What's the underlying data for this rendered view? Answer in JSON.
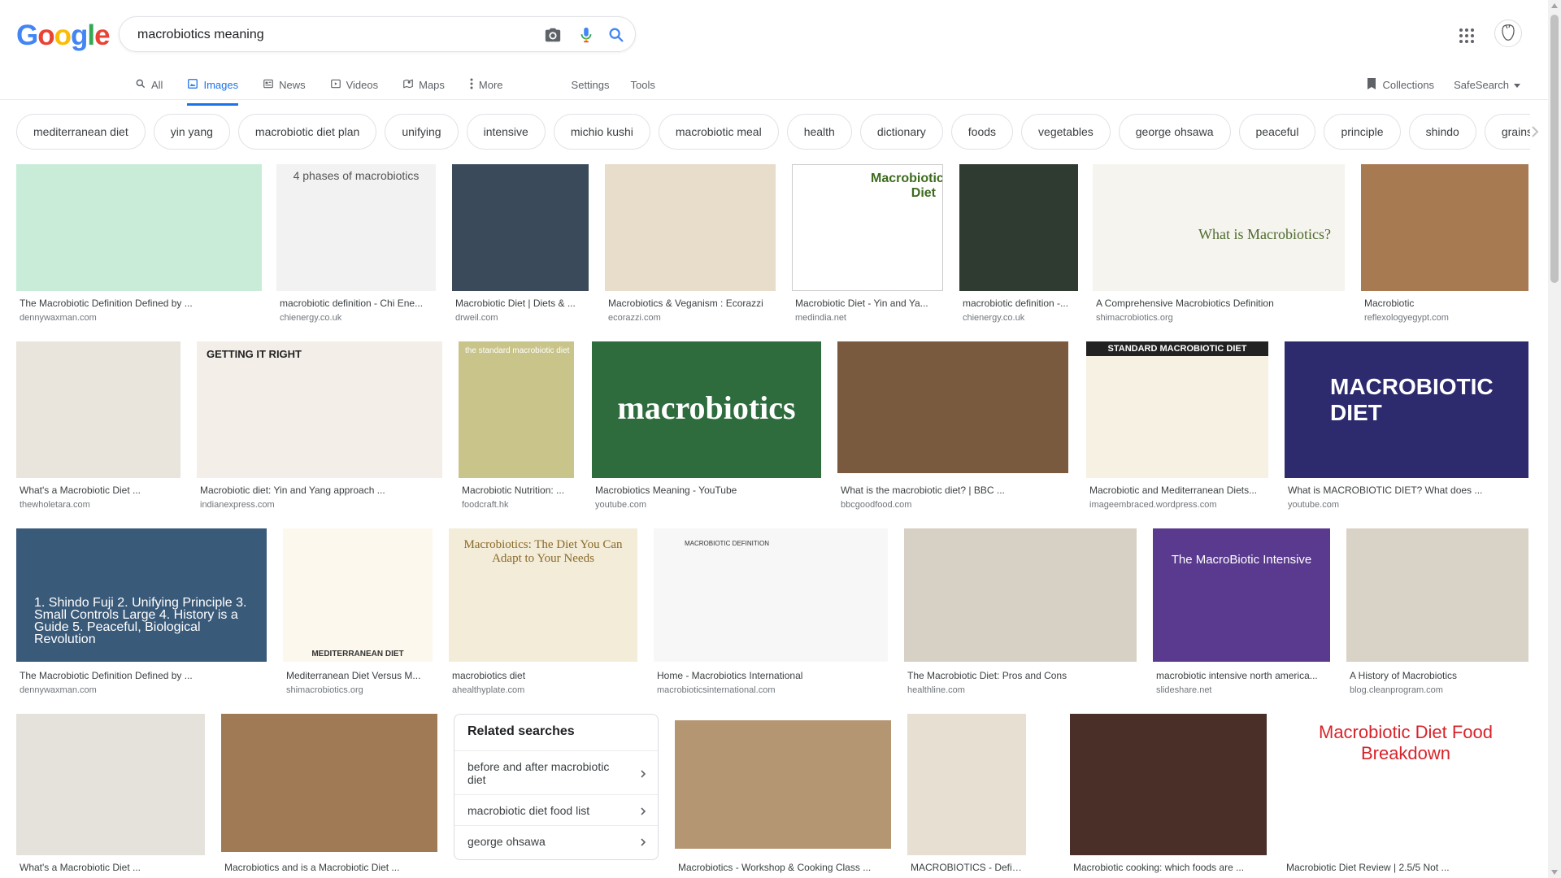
{
  "logo": {
    "letters": [
      "G",
      "o",
      "o",
      "g",
      "l",
      "e"
    ],
    "colors": [
      "#4285F4",
      "#EA4335",
      "#FBBC05",
      "#4285F4",
      "#34A853",
      "#EA4335"
    ]
  },
  "search": {
    "value": "macrobiotics meaning"
  },
  "tabs": [
    {
      "label": "All",
      "icon": "search-icon"
    },
    {
      "label": "Images",
      "icon": "image-icon",
      "active": true
    },
    {
      "label": "News",
      "icon": "news-icon"
    },
    {
      "label": "Videos",
      "icon": "video-icon"
    },
    {
      "label": "Maps",
      "icon": "map-icon"
    },
    {
      "label": "More",
      "icon": "more-vert-icon"
    }
  ],
  "tools": {
    "settings": "Settings",
    "tools": "Tools"
  },
  "right": {
    "collections": "Collections",
    "safesearch": "SafeSearch"
  },
  "chips": [
    "mediterranean diet",
    "yin yang",
    "macrobiotic diet plan",
    "unifying",
    "intensive",
    "michio kushi",
    "macrobiotic meal",
    "health",
    "dictionary",
    "foods",
    "vegetables",
    "george ohsawa",
    "peaceful",
    "principle",
    "shindo",
    "grains"
  ],
  "results": [
    {
      "title": "The Macrobiotic Definition Defined by ...",
      "source": "dennywaxman.com",
      "color": "#c9ecd8",
      "overlay": ""
    },
    {
      "title": "macrobiotic definition - Chi Ene...",
      "source": "chienergy.co.uk",
      "color": "#f2f2f2",
      "overlay": "4 phases of macrobiotics"
    },
    {
      "title": "Macrobiotic Diet | Diets & ...",
      "source": "drweil.com",
      "color": "#3b4a5a",
      "overlay": ""
    },
    {
      "title": "Macrobiotics & Veganism : Ecorazzi",
      "source": "ecorazzi.com",
      "color": "#e8dccb",
      "overlay": ""
    },
    {
      "title": "Macrobiotic Diet - Yin and Ya...",
      "source": "medindia.net",
      "color": "#ffffff",
      "overlay": "Macrobiotic Diet"
    },
    {
      "title": "macrobiotic definition -...",
      "source": "chienergy.co.uk",
      "color": "#2f3a30",
      "overlay": ""
    },
    {
      "title": "A Comprehensive Macrobiotics Definition",
      "source": "shimacrobiotics.org",
      "color": "#f5f4ee",
      "overlay": "What is Macrobiotics?"
    },
    {
      "title": "Macrobiotic",
      "source": "reflexologyegypt.com",
      "color": "#a87a52",
      "overlay": ""
    },
    {
      "title": "What's a Macrobiotic Diet ...",
      "source": "thewholetara.com",
      "color": "#e9e4dc",
      "overlay": ""
    },
    {
      "title": "Macrobiotic diet: Yin and Yang approach ...",
      "source": "indianexpress.com",
      "color": "#f3efe8",
      "overlay": "GETTING IT RIGHT"
    },
    {
      "title": "Macrobiotic Nutrition: ...",
      "source": "foodcraft.hk",
      "color": "#c8c48a",
      "overlay": "the standard macrobiotic diet"
    },
    {
      "title": "Macrobiotics Meaning - YouTube",
      "source": "youtube.com",
      "color": "#2e6b3d",
      "overlay": "macrobiotics"
    },
    {
      "title": "What is the macrobiotic diet? | BBC ...",
      "source": "bbcgoodfood.com",
      "color": "#7a5a3e",
      "overlay": ""
    },
    {
      "title": "Macrobiotic and Mediterranean Diets...",
      "source": "imageembraced.wordpress.com",
      "color": "#f7f1e4",
      "overlay": "STANDARD MACROBIOTIC DIET"
    },
    {
      "title": "What is MACROBIOTIC DIET? What does ...",
      "source": "youtube.com",
      "color": "#2d2a6e",
      "overlay": "MACROBIOTIC DIET"
    },
    {
      "title": "The Macrobiotic Definition Defined by ...",
      "source": "dennywaxman.com",
      "color": "#3a5a7a",
      "overlay": "1. Shindo Fuji 2. Unifying Principle 3. Small Controls Large 4. History is a Guide 5. Peaceful, Biological Revolution"
    },
    {
      "title": "Mediterranean Diet Versus M...",
      "source": "shimacrobiotics.org",
      "color": "#fdf8ee",
      "overlay": "MEDITERRANEAN DIET"
    },
    {
      "title": "macrobiotics diet",
      "source": "ahealthyplate.com",
      "color": "#f3ecd8",
      "overlay": "Macrobiotics: The Diet You Can Adapt to Your Needs"
    },
    {
      "title": "Home - Macrobiotics International",
      "source": "macrobioticsinternational.com",
      "color": "#f7f7f7",
      "overlay": "MACROBIOTIC DEFINITION"
    },
    {
      "title": "The Macrobiotic Diet: Pros and Cons",
      "source": "healthline.com",
      "color": "#d7d0c4",
      "overlay": ""
    },
    {
      "title": "macrobiotic intensive north america...",
      "source": "slideshare.net",
      "color": "#5a3a8e",
      "overlay": "The MacroBiotic Intensive"
    },
    {
      "title": "A History of Macrobiotics",
      "source": "blog.cleanprogram.com",
      "color": "#d9d2c6",
      "overlay": ""
    },
    {
      "title": "What's a Macrobiotic Diet ...",
      "source": "",
      "color": "#e5e2dc",
      "overlay": ""
    },
    {
      "title": "Macrobiotics and is a Macrobiotic Diet ...",
      "source": "",
      "color": "#a07a55",
      "overlay": ""
    },
    {
      "title": "Macrobiotics - Workshop & Cooking Class ...",
      "source": "",
      "color": "#b49672",
      "overlay": ""
    },
    {
      "title": "MACROBIOTICS - Definition...",
      "source": "",
      "color": "#e6dfd2",
      "overlay": ""
    },
    {
      "title": "Macrobiotic cooking: which foods are ...",
      "source": "",
      "color": "#4a2f28",
      "overlay": ""
    },
    {
      "title": "Macrobiotic Diet Review | 2.5/5 Not ...",
      "source": "",
      "color": "#ffffff",
      "overlay": "Macrobiotic Diet Food Breakdown"
    }
  ],
  "related": {
    "title": "Related searches",
    "items": [
      "before and after macrobiotic diet",
      "macrobiotic diet food list",
      "george ohsawa"
    ]
  }
}
